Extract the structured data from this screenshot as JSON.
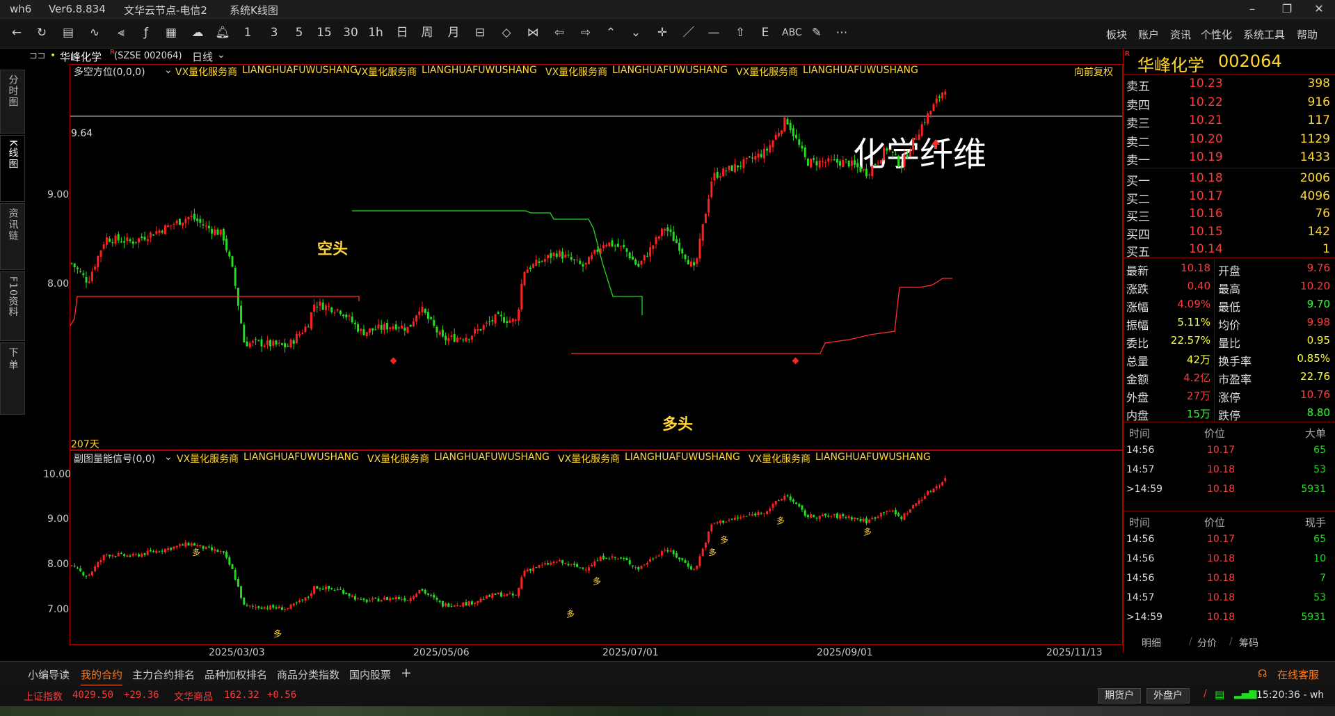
{
  "window": {
    "title": "wh6",
    "version": "Ver6.8.834",
    "node": "文华云节点-电信2",
    "view": "系统K线图",
    "controls": [
      "–",
      "❐",
      "✕"
    ]
  },
  "toolbar": {
    "periods": [
      "1",
      "3",
      "5",
      "15",
      "30",
      "1h",
      "日",
      "周",
      "月"
    ],
    "text_tool": "ABC",
    "menu": [
      "板块",
      "账户",
      "资讯",
      "个性化",
      "系统工具",
      "帮助"
    ]
  },
  "chart_head": {
    "stock_name": "华峰化学",
    "code": "(SZSE 002064)",
    "period": "日线"
  },
  "side_tabs": [
    "分时图",
    "K线图",
    "资讯链",
    "F10资料",
    "下单"
  ],
  "main_pane": {
    "indicator": "多空方位(0,0,0)",
    "ad": "VX量化服务商",
    "ad_en": "LIANGHUAFUWUSHANG",
    "adjust": "向前复权",
    "y_labels": [
      "9.00",
      "8.00"
    ],
    "price_line_label": "9.64",
    "bars_count": "207天",
    "annotation_sector": "化学纤维",
    "label_short": "空头",
    "label_long": "多头"
  },
  "sub_pane": {
    "indicator": "副图量能信号(0,0)",
    "y_labels": [
      "10.00",
      "9.00",
      "8.00",
      "7.00"
    ],
    "marker": "多"
  },
  "x_dates": [
    "2025/03/03",
    "2025/05/06",
    "2025/07/01",
    "2025/09/01",
    "2025/11/13"
  ],
  "quote": {
    "name": "华峰化学",
    "code": "002064",
    "asks": [
      {
        "label": "卖五",
        "price": "10.23",
        "vol": "398"
      },
      {
        "label": "卖四",
        "price": "10.22",
        "vol": "916"
      },
      {
        "label": "卖三",
        "price": "10.21",
        "vol": "117"
      },
      {
        "label": "卖二",
        "price": "10.20",
        "vol": "1129"
      },
      {
        "label": "卖一",
        "price": "10.19",
        "vol": "1433"
      }
    ],
    "bids": [
      {
        "label": "买一",
        "price": "10.18",
        "vol": "2006"
      },
      {
        "label": "买二",
        "price": "10.17",
        "vol": "4096"
      },
      {
        "label": "买三",
        "price": "10.16",
        "vol": "76"
      },
      {
        "label": "买四",
        "price": "10.15",
        "vol": "142"
      },
      {
        "label": "买五",
        "price": "10.14",
        "vol": "1"
      }
    ],
    "stats": [
      {
        "l1": "最新",
        "v1": "10.18",
        "l2": "开盘",
        "v2": "9.76"
      },
      {
        "l1": "涨跌",
        "v1": "0.40",
        "l2": "最高",
        "v2": "10.20"
      },
      {
        "l1": "涨幅",
        "v1": "4.09%",
        "l2": "最低",
        "v2": "9.70"
      },
      {
        "l1": "振幅",
        "v1": "5.11%",
        "l2": "均价",
        "v2": "9.98"
      },
      {
        "l1": "委比",
        "v1": "22.57%",
        "l2": "量比",
        "v2": "0.95"
      },
      {
        "l1": "总量",
        "v1": "42万",
        "l2": "换手率",
        "v2": "0.85%"
      },
      {
        "l1": "金额",
        "v1": "4.2亿",
        "l2": "市盈率",
        "v2": "22.76"
      },
      {
        "l1": "外盘",
        "v1": "27万",
        "l2": "涨停",
        "v2": "10.76"
      },
      {
        "l1": "内盘",
        "v1": "15万",
        "l2": "跌停",
        "v2": "8.80"
      }
    ],
    "stat_colors": {
      "v1": [
        "#ff3b3b",
        "#ff3b3b",
        "#ff3b3b",
        "#ffff33",
        "#ffff33",
        "#ffff33",
        "#ff3b3b",
        "#ff3b3b",
        "#33ff33"
      ],
      "v2": [
        "#ff3b3b",
        "#ff3b3b",
        "#33ff33",
        "#ff3b3b",
        "#ffff33",
        "#ffff33",
        "#ffff33",
        "#ff3b3b",
        "#33ff33"
      ]
    },
    "ticks1_header": {
      "time": "时间",
      "price": "价位",
      "vol": "大单"
    },
    "ticks1": [
      {
        "time": "14:56",
        "price": "10.17",
        "vol": "65"
      },
      {
        "time": "14:57",
        "price": "10.18",
        "vol": "53"
      },
      {
        "time": ">14:59",
        "price": "10.18",
        "vol": "5931"
      }
    ],
    "ticks2_header": {
      "time": "时间",
      "price": "价位",
      "vol": "现手"
    },
    "ticks2": [
      {
        "time": "14:56",
        "price": "10.17",
        "vol": "65"
      },
      {
        "time": "14:56",
        "price": "10.18",
        "vol": "10"
      },
      {
        "time": "14:56",
        "price": "10.18",
        "vol": "7"
      },
      {
        "time": "14:57",
        "price": "10.18",
        "vol": "53"
      },
      {
        "time": ">14:59",
        "price": "10.18",
        "vol": "5931"
      }
    ],
    "tabs": [
      "明细",
      "分价",
      "筹码"
    ]
  },
  "bottom_tabs": [
    "小编导读",
    "我的合约",
    "主力合约排名",
    "品种加权排名",
    "商品分类指数",
    "国内股票",
    "+"
  ],
  "service": "在线客服",
  "status": {
    "index1_name": "上证指数",
    "index1_val": "4029.50",
    "index1_chg": "+29.36",
    "index2_name": "文华商品",
    "index2_val": "162.32",
    "index2_chg": "+0.56",
    "btn_futures": "期货户",
    "btn_otc": "外盘户",
    "time": "15:20:36 - wh"
  },
  "colors": {
    "up": "#ff2020",
    "down": "#22dd22",
    "frame": "#b00000",
    "label_yellow": "#ffd633"
  }
}
